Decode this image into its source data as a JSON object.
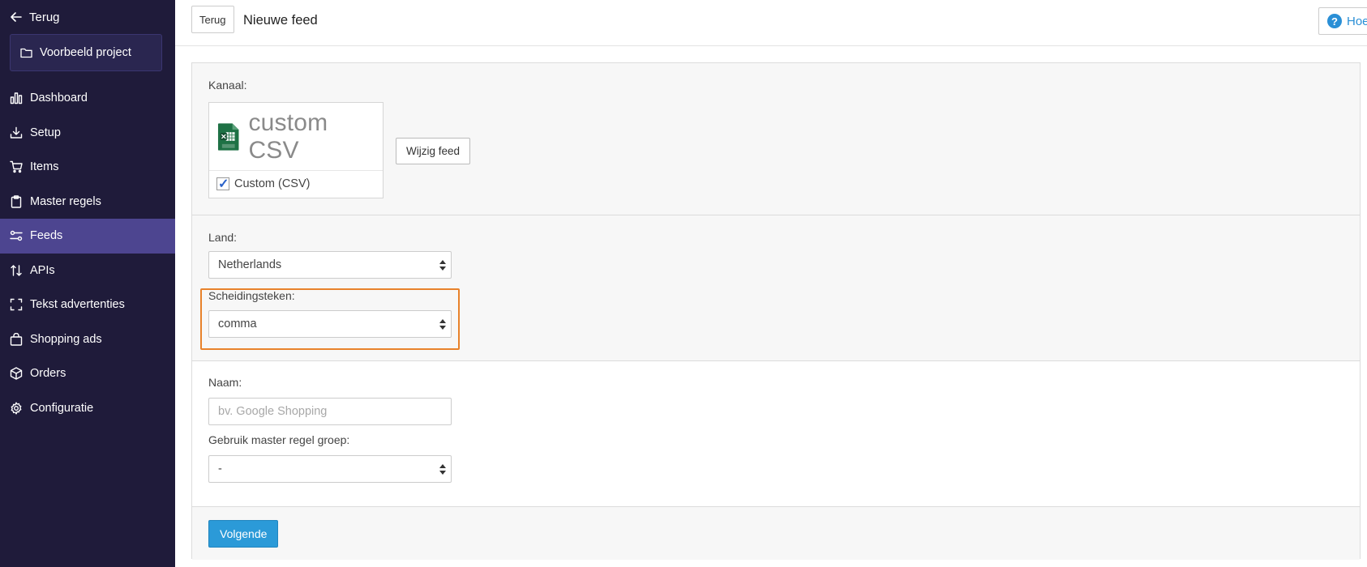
{
  "sidebar": {
    "back_label": "Terug",
    "project_label": "Voorbeeld project",
    "items": [
      {
        "label": "Dashboard",
        "icon": "bar-chart-icon"
      },
      {
        "label": "Setup",
        "icon": "download-tray-icon"
      },
      {
        "label": "Items",
        "icon": "cart-icon"
      },
      {
        "label": "Master regels",
        "icon": "clipboard-icon"
      },
      {
        "label": "Feeds",
        "icon": "sliders-icon",
        "active": true
      },
      {
        "label": "APIs",
        "icon": "arrows-updown-icon"
      },
      {
        "label": "Tekst advertenties",
        "icon": "frame-corners-icon"
      },
      {
        "label": "Shopping ads",
        "icon": "shopping-bag-icon"
      },
      {
        "label": "Orders",
        "icon": "box-icon"
      },
      {
        "label": "Configuratie",
        "icon": "gear-icon"
      }
    ]
  },
  "topbar": {
    "back_button": "Terug",
    "title": "Nieuwe feed",
    "help_label": "Hoe"
  },
  "form": {
    "channel": {
      "label": "Kanaal:",
      "logo_text": "custom CSV",
      "option_label": "Custom (CSV)",
      "checked": true,
      "change_button": "Wijzig feed"
    },
    "country": {
      "label": "Land:",
      "value": "Netherlands"
    },
    "separator": {
      "label": "Scheidingsteken:",
      "value": "comma"
    },
    "name": {
      "label": "Naam:",
      "value": "",
      "placeholder": "bv. Google Shopping"
    },
    "master_group": {
      "label": "Gebruik master regel groep:",
      "value": "-"
    },
    "next_button": "Volgende"
  },
  "colors": {
    "sidebar_bg": "#1f1b3a",
    "sidebar_active": "#4d4590",
    "primary": "#2b9ad8",
    "highlight": "#e8822b",
    "excel_green": "#1e7145"
  }
}
